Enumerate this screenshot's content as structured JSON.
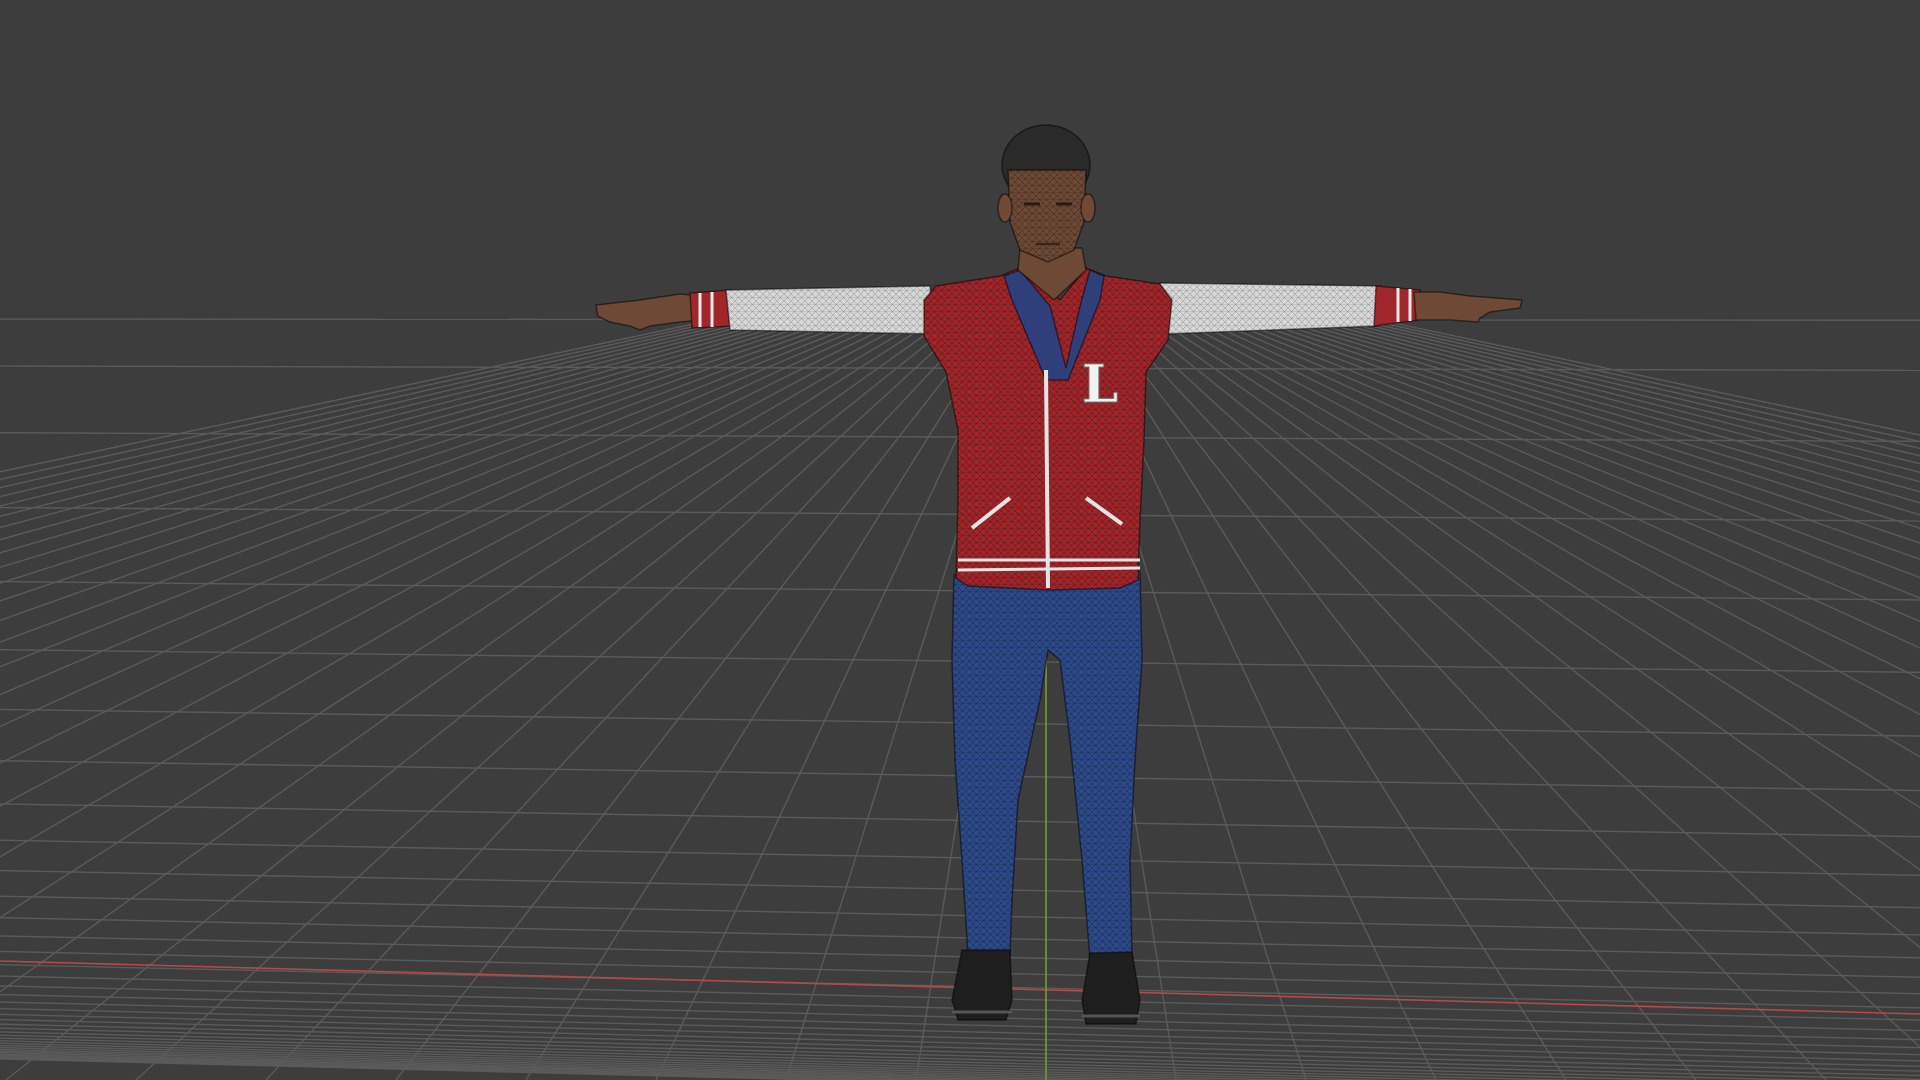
{
  "app": {
    "view": "3d-viewport",
    "shading": "solid-with-wireframe-overlay",
    "background_color": "#3d3d3d",
    "grid_color": "#5a5a5a",
    "x_axis_color": "#b54848",
    "y_axis_color": "#6f9a2e"
  },
  "model": {
    "pose": "T-pose",
    "jacket_color": "#a1262b",
    "sleeve_color": "#d8d8d8",
    "shirt_color": "#2f3f7a",
    "pants_color": "#2d4a8a",
    "shoe_color": "#1e1e1e",
    "skin_color": "#6e4a36",
    "hair_color": "#2a2a2a",
    "chest_letter": "L"
  }
}
